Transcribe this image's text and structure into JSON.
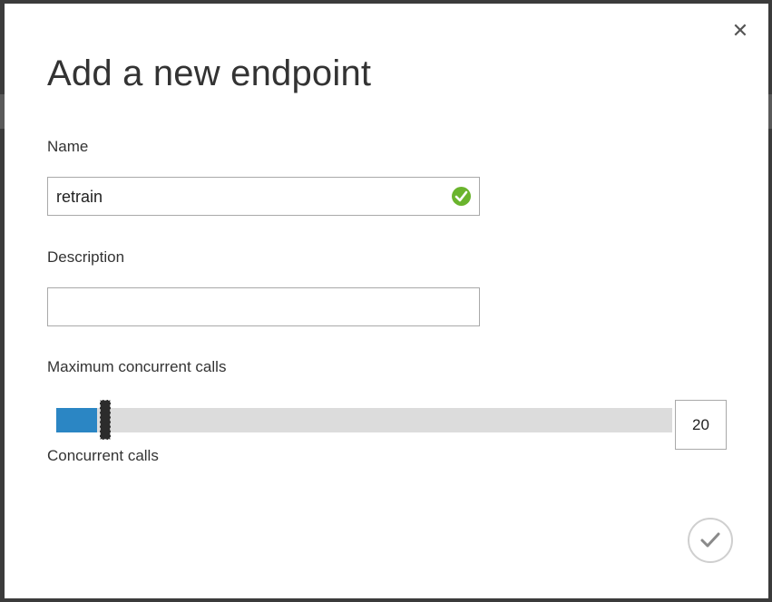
{
  "dialog": {
    "title": "Add a new endpoint",
    "close_icon": "close-icon",
    "close_glyph": "✕"
  },
  "name_field": {
    "label": "Name",
    "value": "retrain",
    "status_icon": "check-circle-icon",
    "status_color": "#6ab42d"
  },
  "description_field": {
    "label": "Description",
    "value": ""
  },
  "concurrency": {
    "label": "Maximum concurrent calls",
    "value": "20",
    "sublabel": "Concurrent calls",
    "fill_color": "#2b86c4",
    "track_color": "#dcdcdc"
  },
  "confirm": {
    "icon": "checkmark-icon"
  }
}
